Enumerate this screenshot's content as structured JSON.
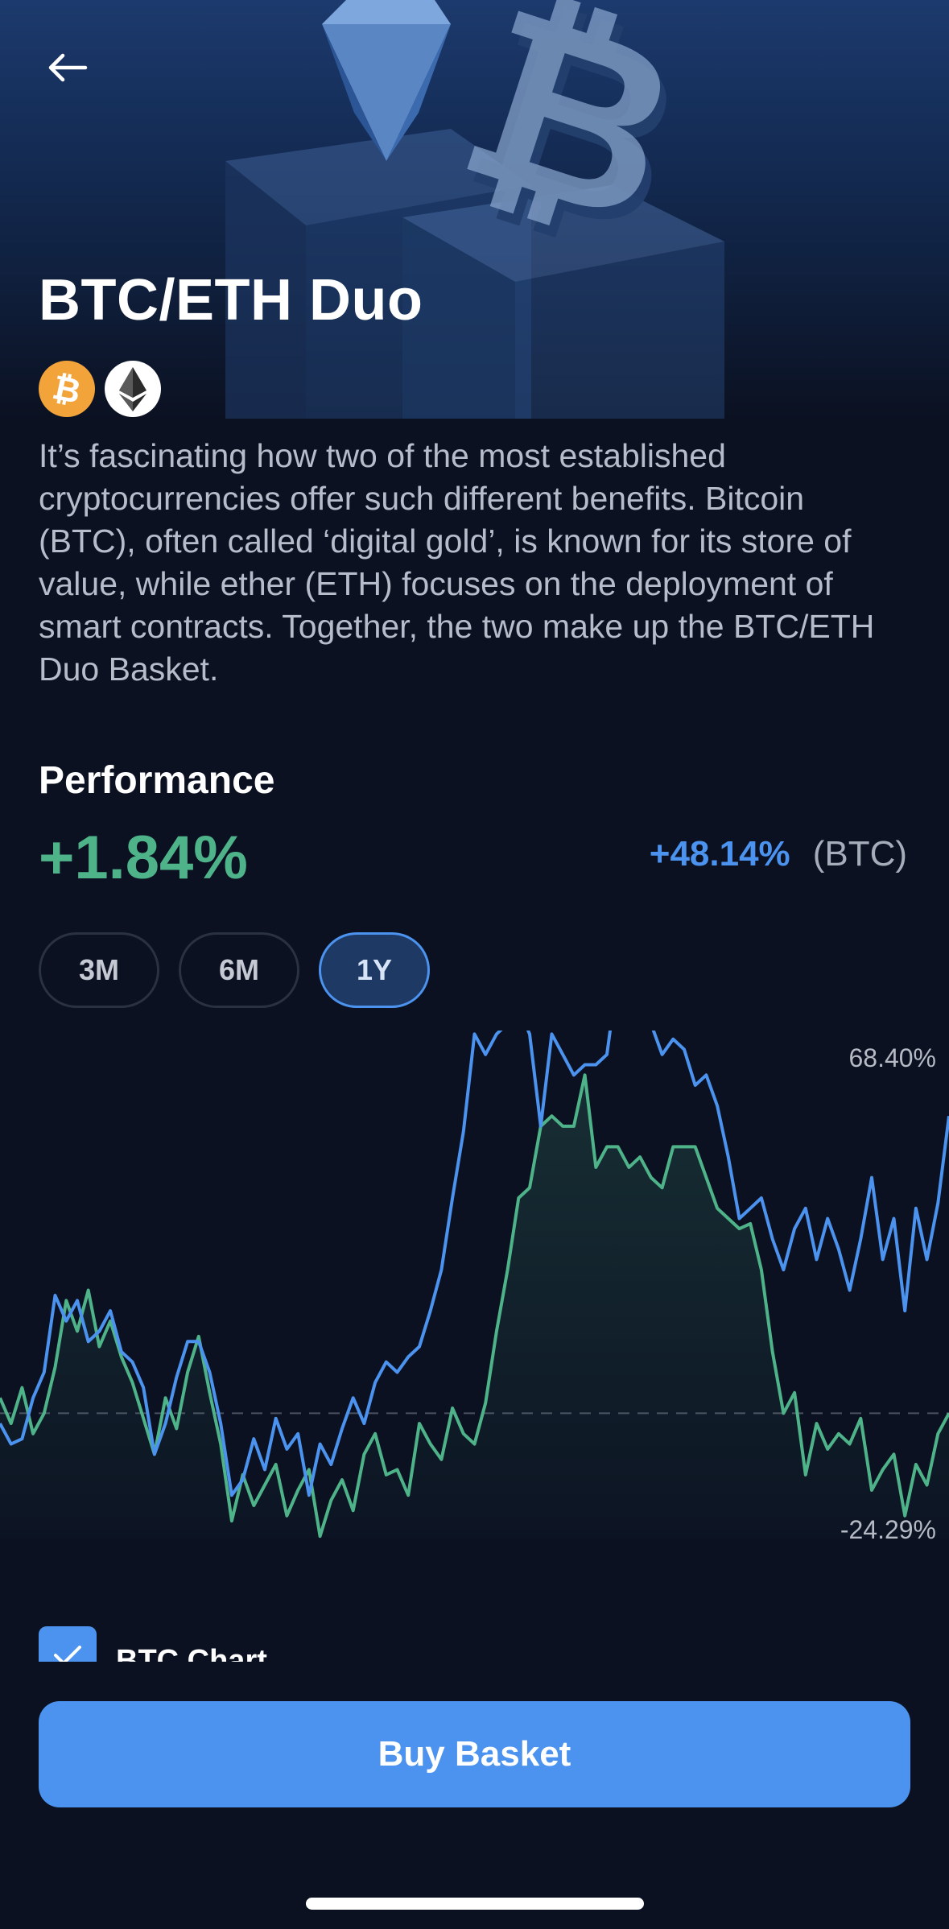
{
  "header": {
    "back_icon": "arrow-left-icon",
    "title": "BTC/ETH Duo"
  },
  "coins": [
    {
      "icon": "bitcoin-icon",
      "color": "#f2a33a"
    },
    {
      "icon": "ethereum-icon",
      "color": "#ffffff"
    }
  ],
  "description": "It’s fascinating how two of the most established cryptocurrencies offer such different benefits. Bitcoin (BTC), often called ‘digital gold’, is known for its store of value, while ether (ETH) focuses on the deployment of smart contracts. Together, the two make up the BTC/ETH Duo Basket.",
  "performance": {
    "heading": "Performance",
    "value": "+1.84%",
    "btc_value": "+48.14%",
    "btc_label": "(BTC)"
  },
  "ranges": [
    {
      "label": "3M",
      "active": false
    },
    {
      "label": "6M",
      "active": false
    },
    {
      "label": "1Y",
      "active": true
    }
  ],
  "chart": {
    "max_label": "68.40%",
    "min_label": "-24.29%"
  },
  "chart_data": {
    "type": "line",
    "ylim": [
      -24.29,
      68.4
    ],
    "baseline": 0,
    "series": [
      {
        "name": "BTC/ETH Duo",
        "color": "#4fb38a",
        "values": [
          3,
          -2,
          5,
          -4,
          0,
          9,
          22,
          16,
          24,
          13,
          18,
          11,
          6,
          -1,
          -8,
          3,
          -3,
          8,
          15,
          4,
          -6,
          -21,
          -12,
          -18,
          -14,
          -10,
          -20,
          -15,
          -11,
          -24,
          -17,
          -13,
          -19,
          -8,
          -4,
          -12,
          -11,
          -16,
          -2,
          -6,
          -9,
          1,
          -4,
          -6,
          2,
          16,
          28,
          42,
          44,
          56,
          58,
          56,
          56,
          66,
          48,
          52,
          52,
          48,
          50,
          46,
          44,
          52,
          52,
          52,
          46,
          40,
          38,
          36,
          37,
          28,
          12,
          0,
          4,
          -12,
          -2,
          -7,
          -4,
          -6,
          -1,
          -15,
          -11,
          -8,
          -20,
          -10,
          -14,
          -4,
          0
        ]
      },
      {
        "name": "BTC",
        "color": "#4b93ee",
        "values": [
          -2,
          -6,
          -5,
          3,
          8,
          23,
          18,
          22,
          14,
          16,
          20,
          12,
          10,
          5,
          -8,
          -2,
          7,
          14,
          14,
          8,
          -2,
          -16,
          -13,
          -5,
          -11,
          -1,
          -7,
          -4,
          -16,
          -6,
          -10,
          -3,
          3,
          -2,
          6,
          10,
          8,
          11,
          13,
          20,
          28,
          42,
          55,
          74,
          70,
          74,
          76,
          79,
          74,
          56,
          74,
          70,
          66,
          68,
          68,
          70,
          86,
          86,
          86,
          76,
          70,
          73,
          71,
          64,
          66,
          60,
          50,
          38,
          40,
          42,
          34,
          28,
          36,
          40,
          30,
          38,
          32,
          24,
          34,
          46,
          30,
          38,
          20,
          40,
          30,
          41,
          58
        ]
      }
    ]
  },
  "btc_toggle": {
    "label": "BTC Chart",
    "checked": true
  },
  "buy_button": {
    "label": "Buy Basket"
  },
  "colors": {
    "background": "#0b1121",
    "accent": "#4b93ee",
    "positive": "#4fb38a"
  }
}
